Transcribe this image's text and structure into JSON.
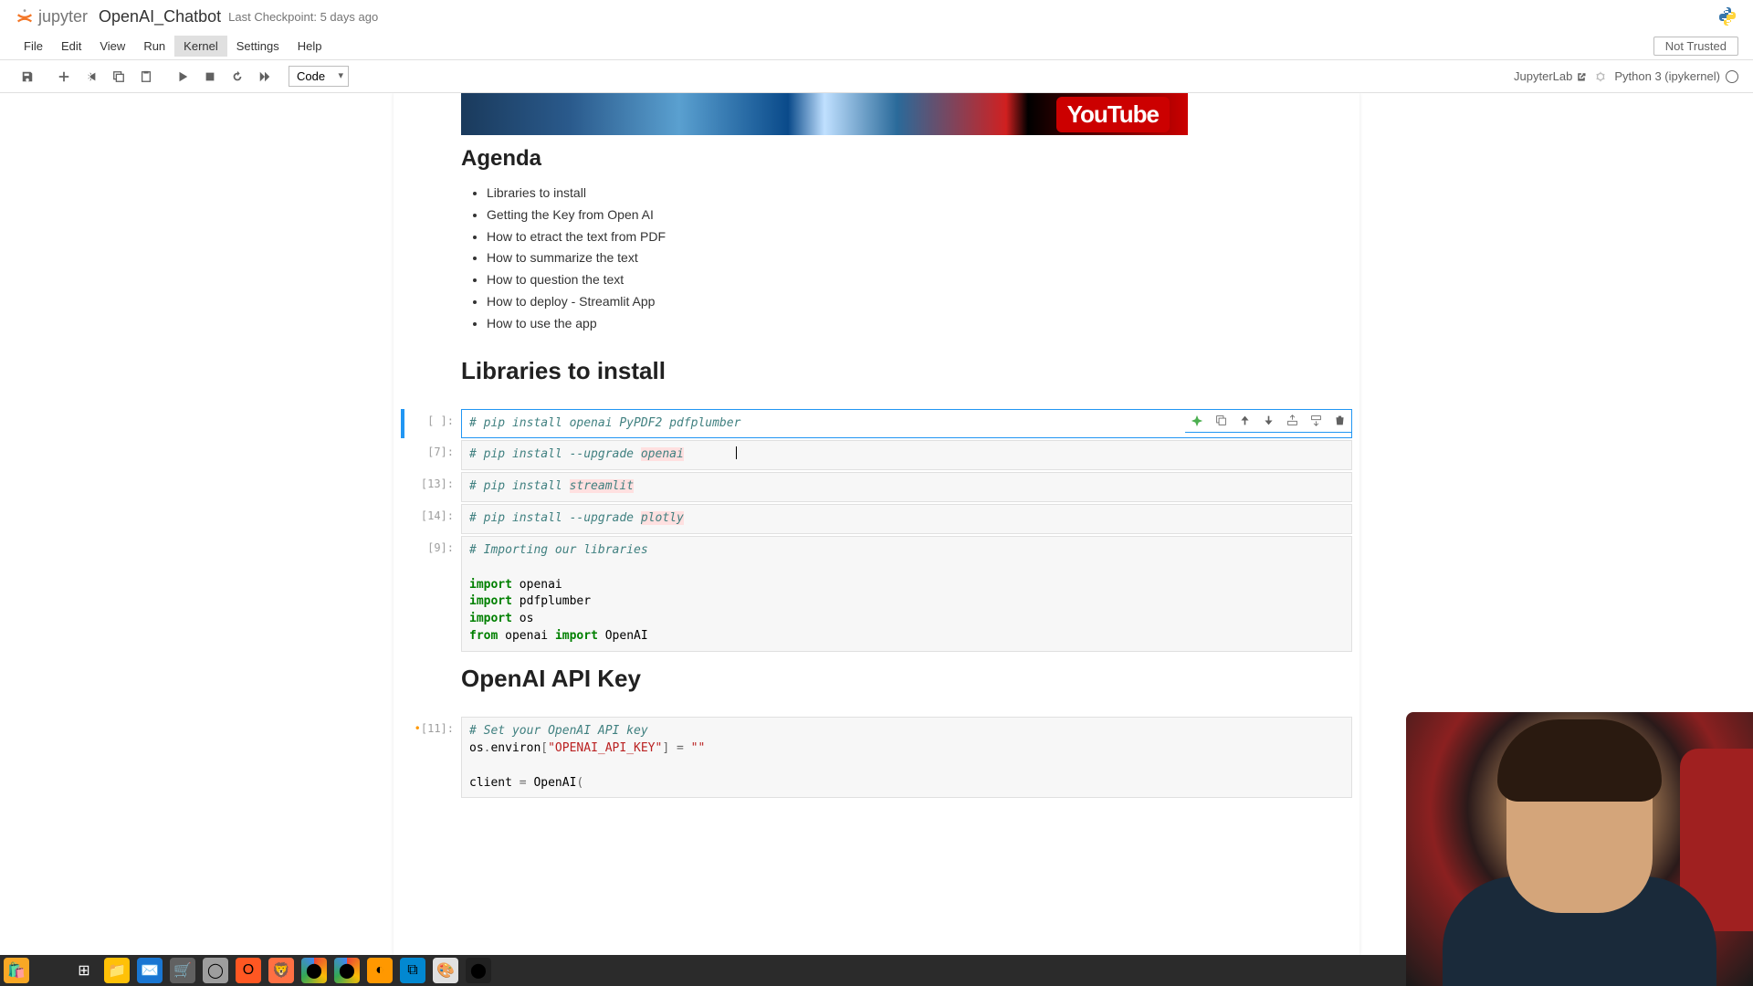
{
  "header": {
    "jupyter": "jupyter",
    "title": "OpenAI_Chatbot",
    "checkpoint": "Last Checkpoint: 5 days ago"
  },
  "menu": [
    "File",
    "Edit",
    "View",
    "Run",
    "Kernel",
    "Settings",
    "Help"
  ],
  "menu_active_index": 4,
  "trust": "Not Trusted",
  "toolbar": {
    "cell_type": "Code",
    "jupyterlab": "JupyterLab",
    "kernel": "Python 3 (ipykernel)"
  },
  "banner": {
    "youtube": "YouTube"
  },
  "sections": {
    "agenda_title": "Agenda",
    "agenda_items": [
      "Libraries to install",
      "Getting the Key from Open AI",
      "How to etract the text from PDF",
      "How to summarize the text",
      "How to question the text",
      "How to deploy - Streamlit App",
      "How to use the app"
    ],
    "libs_title": "Libraries to install",
    "openai_key_title": "OpenAI API Key"
  },
  "cells": [
    {
      "prompt": "[ ]:",
      "code": "# pip install openai PyPDF2 pdfplumber",
      "selected": true
    },
    {
      "prompt": "[7]:",
      "code": "# pip install --upgrade openai",
      "highlight": "openai"
    },
    {
      "prompt": "[13]:",
      "code": "# pip install streamlit",
      "highlight": "streamlit"
    },
    {
      "prompt": "[14]:",
      "code": "# pip install --upgrade plotly",
      "highlight": "plotly"
    },
    {
      "prompt": "[9]:",
      "lines": [
        {
          "t": "comment",
          "v": "# Importing our libraries"
        },
        {
          "t": "blank"
        },
        {
          "t": "import",
          "mod": "openai"
        },
        {
          "t": "import",
          "mod": "pdfplumber"
        },
        {
          "t": "import",
          "mod": "os"
        },
        {
          "t": "from",
          "pkg": "openai",
          "mod": "OpenAI"
        }
      ]
    },
    {
      "prompt": "[11]:",
      "unsaved": true,
      "lines": [
        {
          "t": "comment",
          "v": "# Set your OpenAI API key"
        },
        {
          "t": "envset",
          "obj": "os",
          "attr": "environ",
          "key": "\"OPENAI_API_KEY\"",
          "val": "\"\""
        },
        {
          "t": "blank"
        },
        {
          "t": "assign",
          "lhs": "client",
          "rhs": "OpenAI("
        }
      ]
    }
  ]
}
